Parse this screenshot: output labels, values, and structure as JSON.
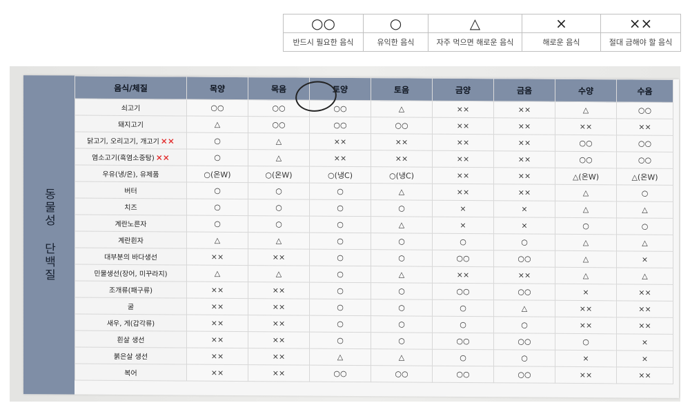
{
  "legend": {
    "symbols": [
      "○○",
      "○",
      "△",
      "×",
      "××"
    ],
    "descriptions": [
      "반드시 필요한 음식",
      "유익한 음식",
      "자주 먹으면 해로운 음식",
      "해로운 음식",
      "절대 금해야 할 음식"
    ]
  },
  "section_label": "동물성 단백질",
  "header": [
    "음식/체질",
    "목양",
    "목음",
    "토양",
    "토음",
    "금양",
    "금음",
    "수양",
    "수음"
  ],
  "red_mark": "××",
  "rows": [
    {
      "label": "쇠고기",
      "cells": [
        "○○",
        "○○",
        "○○",
        "△",
        "××",
        "××",
        "△",
        "○○"
      ]
    },
    {
      "label": "돼지고기",
      "cells": [
        "△",
        "○○",
        "○○",
        "○○",
        "××",
        "××",
        "××",
        "××"
      ]
    },
    {
      "label": "닭고기, 오리고기, 개고기",
      "mark": true,
      "cells": [
        "○",
        "△",
        "××",
        "××",
        "××",
        "××",
        "○○",
        "○○"
      ]
    },
    {
      "label": "염소고기(흑염소중탕)",
      "mark": true,
      "cells": [
        "○",
        "△",
        "××",
        "××",
        "××",
        "××",
        "○○",
        "○○"
      ]
    },
    {
      "label": "우유(냉/온), 유제품",
      "cells": [
        "○(온W)",
        "○(온W)",
        "○(냉C)",
        "○(냉C)",
        "××",
        "××",
        "△(온W)",
        "△(온W)"
      ]
    },
    {
      "label": "버터",
      "cells": [
        "○",
        "○",
        "○",
        "△",
        "××",
        "××",
        "△",
        "○"
      ]
    },
    {
      "label": "치즈",
      "cells": [
        "○",
        "○",
        "○",
        "○",
        "×",
        "×",
        "△",
        "△"
      ]
    },
    {
      "label": "계란노른자",
      "cells": [
        "○",
        "○",
        "○",
        "△",
        "×",
        "×",
        "○",
        "○"
      ]
    },
    {
      "label": "계란흰자",
      "cells": [
        "△",
        "△",
        "○",
        "○",
        "○",
        "○",
        "△",
        "△"
      ]
    },
    {
      "label": "대부분의 바다생선",
      "cells": [
        "××",
        "××",
        "○",
        "○",
        "○○",
        "○○",
        "△",
        "×"
      ]
    },
    {
      "label": "민물생선(장어, 미꾸라지)",
      "cells": [
        "△",
        "△",
        "○",
        "△",
        "××",
        "××",
        "△",
        "△"
      ]
    },
    {
      "label": "조개류(패구류)",
      "cells": [
        "××",
        "××",
        "○",
        "○",
        "○○",
        "○○",
        "×",
        "××"
      ]
    },
    {
      "label": "굴",
      "cells": [
        "××",
        "××",
        "○",
        "○",
        "○",
        "△",
        "××",
        "××"
      ]
    },
    {
      "label": "새우, 게(갑각류)",
      "cells": [
        "××",
        "××",
        "○",
        "○",
        "○",
        "○",
        "××",
        "××"
      ]
    },
    {
      "label": "흰살 생선",
      "cells": [
        "××",
        "××",
        "○",
        "○",
        "○○",
        "○○",
        "○",
        "×"
      ]
    },
    {
      "label": "붉은살 생선",
      "cells": [
        "××",
        "××",
        "△",
        "△",
        "○",
        "○",
        "×",
        "×"
      ]
    },
    {
      "label": "복어",
      "cells": [
        "××",
        "××",
        "○○",
        "○○",
        "○○",
        "○○",
        "××",
        "××"
      ]
    }
  ]
}
